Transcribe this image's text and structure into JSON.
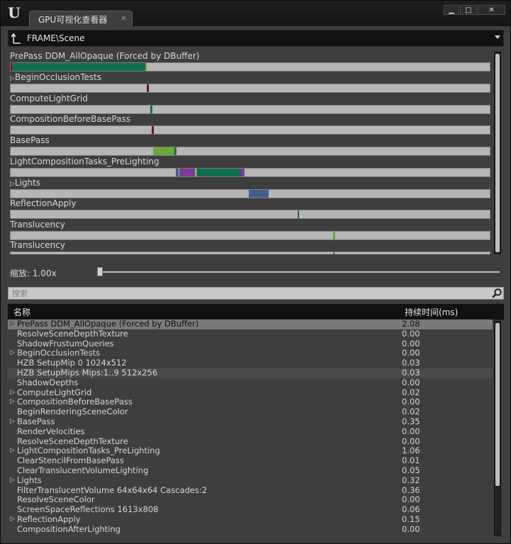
{
  "window": {
    "tab_title": "GPU可视化查看器",
    "tab_close": "×",
    "btn_minimize": "▁",
    "btn_maximize": "□",
    "btn_close": "✕"
  },
  "path": {
    "text": "FRAME\\Scene"
  },
  "timeline": {
    "rows": [
      {
        "label": "PrePass DDM_AllOpaque (Forced by DBuffer)",
        "expandable": false
      },
      {
        "label": "BeginOcclusionTests",
        "expandable": true
      },
      {
        "label": "ComputeLightGrid",
        "expandable": false
      },
      {
        "label": "CompositionBeforeBasePass",
        "expandable": false
      },
      {
        "label": "BasePass",
        "expandable": false
      },
      {
        "label": "LightCompositionTasks_PreLighting",
        "expandable": false
      },
      {
        "label": "Lights",
        "expandable": true
      },
      {
        "label": "ReflectionApply",
        "expandable": false
      },
      {
        "label": "Translucency",
        "expandable": false
      },
      {
        "label": "Translucency",
        "expandable": false
      }
    ],
    "expand_glyph": "▷"
  },
  "zoom": {
    "label": "缩放: 1.00x",
    "value": 1.0
  },
  "search": {
    "placeholder": "搜索",
    "value": ""
  },
  "list": {
    "col_name": "名称",
    "col_duration": "持续时间(ms)",
    "rows": [
      {
        "name": "PrePass DDM_AllOpaque (Forced by DBuffer)",
        "value": "2.08",
        "expandable": true,
        "state": "selected"
      },
      {
        "name": "ResolveSceneDepthTexture",
        "value": "0.00",
        "expandable": false,
        "state": ""
      },
      {
        "name": "ShadowFrustumQueries",
        "value": "0.00",
        "expandable": false,
        "state": ""
      },
      {
        "name": "BeginOcclusionTests",
        "value": "0.00",
        "expandable": true,
        "state": ""
      },
      {
        "name": "HZB SetupMip 0 1024x512",
        "value": "0.03",
        "expandable": false,
        "state": ""
      },
      {
        "name": "HZB SetupMips Mips:1..9 512x256",
        "value": "0.03",
        "expandable": false,
        "state": "alt"
      },
      {
        "name": "ShadowDepths",
        "value": "0.00",
        "expandable": false,
        "state": ""
      },
      {
        "name": "ComputeLightGrid",
        "value": "0.02",
        "expandable": true,
        "state": ""
      },
      {
        "name": "CompositionBeforeBasePass",
        "value": "0.00",
        "expandable": true,
        "state": ""
      },
      {
        "name": "BeginRenderingSceneColor",
        "value": "0.02",
        "expandable": false,
        "state": ""
      },
      {
        "name": "BasePass",
        "value": "0.35",
        "expandable": true,
        "state": ""
      },
      {
        "name": "RenderVelocities",
        "value": "0.00",
        "expandable": false,
        "state": ""
      },
      {
        "name": "ResolveSceneDepthTexture",
        "value": "0.00",
        "expandable": false,
        "state": ""
      },
      {
        "name": "LightCompositionTasks_PreLighting",
        "value": "1.06",
        "expandable": true,
        "state": ""
      },
      {
        "name": "ClearStencilFromBasePass",
        "value": "0.01",
        "expandable": false,
        "state": ""
      },
      {
        "name": "ClearTranslucentVolumeLighting",
        "value": "0.05",
        "expandable": false,
        "state": ""
      },
      {
        "name": "Lights",
        "value": "0.32",
        "expandable": true,
        "state": ""
      },
      {
        "name": "FilterTranslucentVolume 64x64x64 Cascades:2",
        "value": "0.36",
        "expandable": false,
        "state": ""
      },
      {
        "name": "ResolveSceneColor",
        "value": "0.00",
        "expandable": false,
        "state": ""
      },
      {
        "name": "ScreenSpaceReflections 1613x808",
        "value": "0.06",
        "expandable": false,
        "state": ""
      },
      {
        "name": "ReflectionApply",
        "value": "0.15",
        "expandable": true,
        "state": ""
      },
      {
        "name": "CompositionAfterLighting",
        "value": "0.00",
        "expandable": false,
        "state": ""
      }
    ]
  },
  "colors": {
    "green": "#0f6e4e",
    "maroon": "#6e1030",
    "lime": "#6aa83a",
    "purple": "#7d3a9a",
    "blue": "#3e5f8a",
    "bar_bg": "#b6b6b6",
    "selected": "#7a7a7a"
  }
}
